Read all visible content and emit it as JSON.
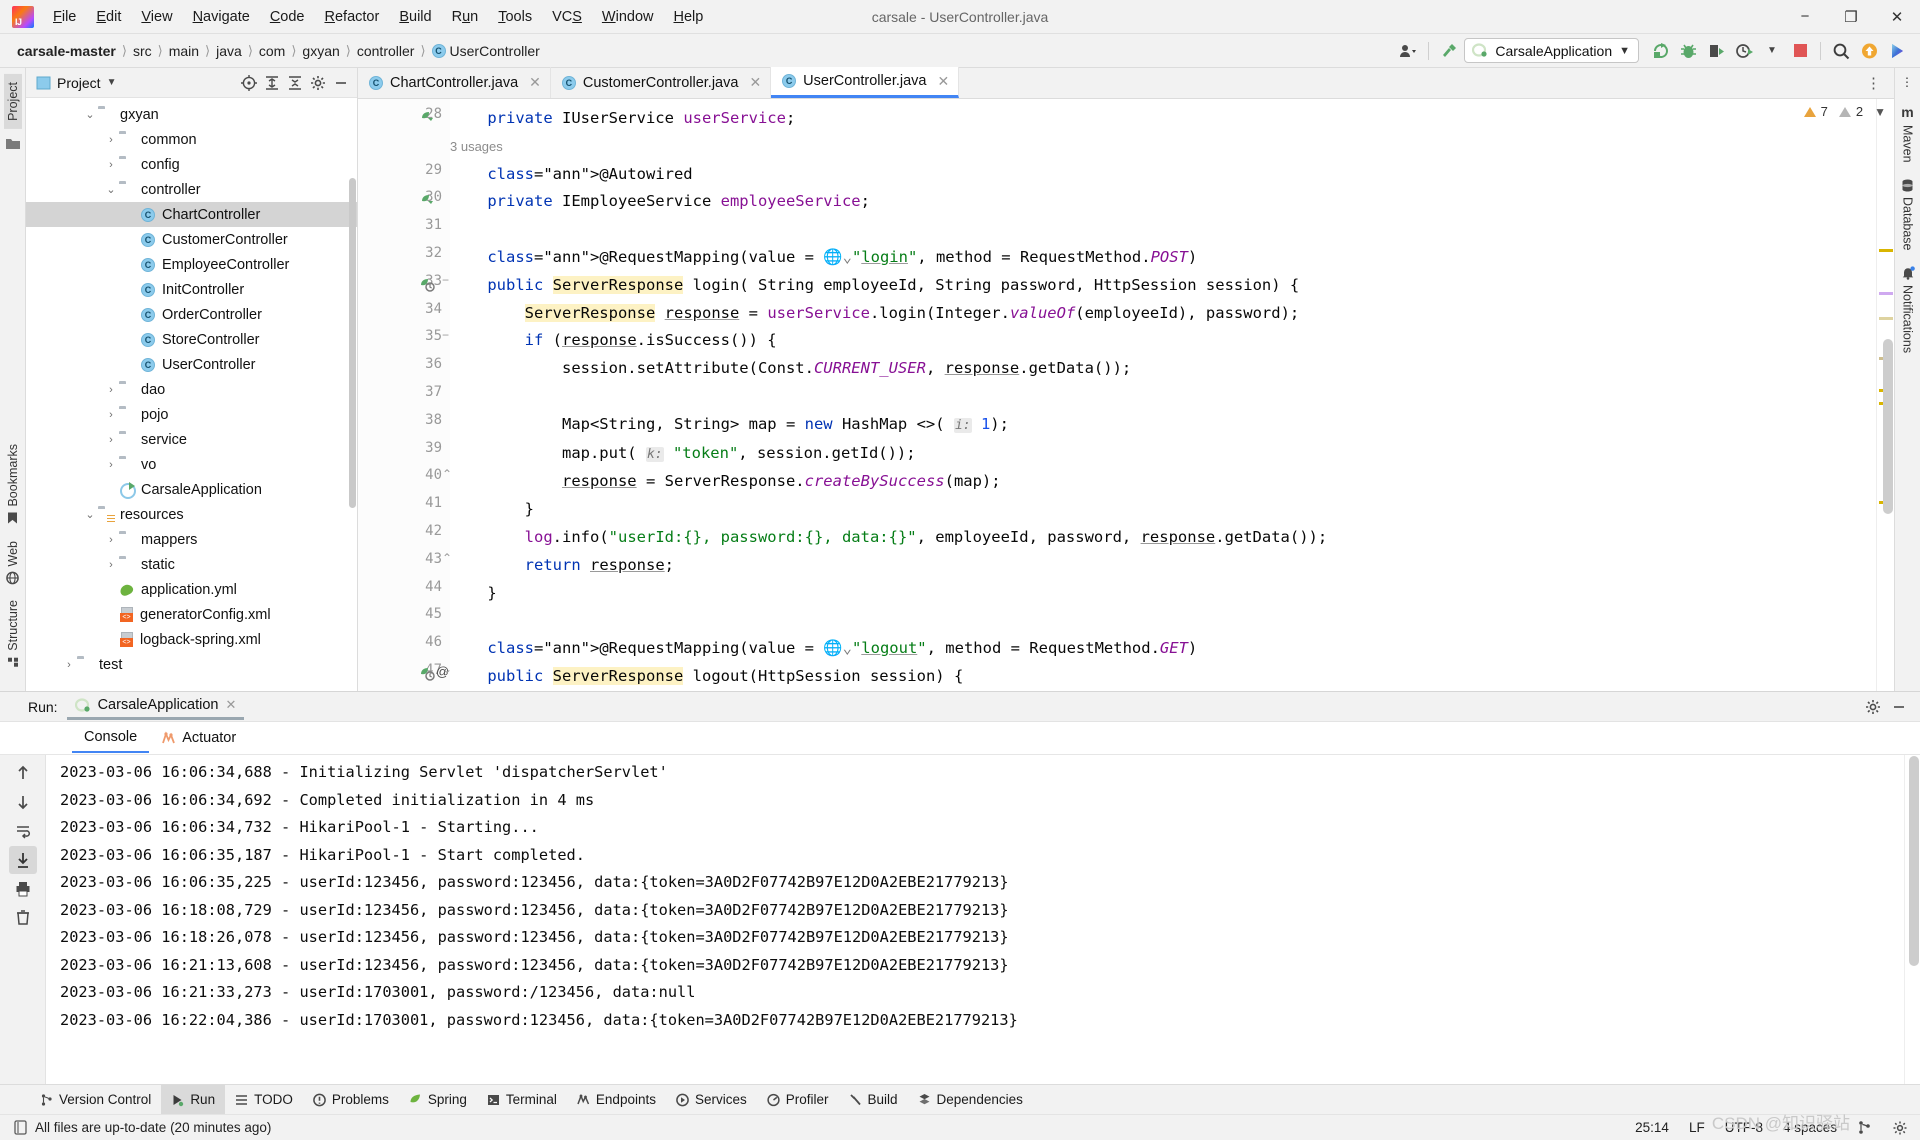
{
  "window": {
    "title": "carsale - UserController.java",
    "menu": [
      "File",
      "Edit",
      "View",
      "Navigate",
      "Code",
      "Refactor",
      "Build",
      "Run",
      "Tools",
      "VCS",
      "Window",
      "Help"
    ],
    "minimize": "−",
    "maximize": "❐",
    "close": "✕"
  },
  "navbar": {
    "breadcrumbs": [
      "carsale-master",
      "src",
      "main",
      "java",
      "com",
      "gxyan",
      "controller",
      "UserController"
    ],
    "separator": "〉",
    "run_config": "CarsaleApplication",
    "dropdown_caret": "▾"
  },
  "project_panel": {
    "title": "Project",
    "caret": "▾",
    "tree": [
      {
        "label": "gxyan",
        "indent": 2,
        "arrow": "open",
        "icon": "folder",
        "selected": false
      },
      {
        "label": "common",
        "indent": 3,
        "arrow": "closed",
        "icon": "folder",
        "selected": false
      },
      {
        "label": "config",
        "indent": 3,
        "arrow": "closed",
        "icon": "folder",
        "selected": false
      },
      {
        "label": "controller",
        "indent": 3,
        "arrow": "open",
        "icon": "folder",
        "selected": false
      },
      {
        "label": "ChartController",
        "indent": 4,
        "arrow": "none",
        "icon": "class",
        "selected": true
      },
      {
        "label": "CustomerController",
        "indent": 4,
        "arrow": "none",
        "icon": "class",
        "selected": false
      },
      {
        "label": "EmployeeController",
        "indent": 4,
        "arrow": "none",
        "icon": "class",
        "selected": false
      },
      {
        "label": "InitController",
        "indent": 4,
        "arrow": "none",
        "icon": "class",
        "selected": false
      },
      {
        "label": "OrderController",
        "indent": 4,
        "arrow": "none",
        "icon": "class",
        "selected": false
      },
      {
        "label": "StoreController",
        "indent": 4,
        "arrow": "none",
        "icon": "class",
        "selected": false
      },
      {
        "label": "UserController",
        "indent": 4,
        "arrow": "none",
        "icon": "class",
        "selected": false
      },
      {
        "label": "dao",
        "indent": 3,
        "arrow": "closed",
        "icon": "folder",
        "selected": false
      },
      {
        "label": "pojo",
        "indent": 3,
        "arrow": "closed",
        "icon": "folder",
        "selected": false
      },
      {
        "label": "service",
        "indent": 3,
        "arrow": "closed",
        "icon": "folder",
        "selected": false
      },
      {
        "label": "vo",
        "indent": 3,
        "arrow": "closed",
        "icon": "folder",
        "selected": false
      },
      {
        "label": "CarsaleApplication",
        "indent": 3,
        "arrow": "none",
        "icon": "spring-class",
        "selected": false
      },
      {
        "label": "resources",
        "indent": 2,
        "arrow": "open",
        "icon": "resources",
        "selected": false
      },
      {
        "label": "mappers",
        "indent": 3,
        "arrow": "closed",
        "icon": "folder-plain",
        "selected": false
      },
      {
        "label": "static",
        "indent": 3,
        "arrow": "closed",
        "icon": "folder-plain",
        "selected": false
      },
      {
        "label": "application.yml",
        "indent": 3,
        "arrow": "none",
        "icon": "yml",
        "selected": false
      },
      {
        "label": "generatorConfig.xml",
        "indent": 3,
        "arrow": "none",
        "icon": "xml",
        "selected": false
      },
      {
        "label": "logback-spring.xml",
        "indent": 3,
        "arrow": "none",
        "icon": "xml",
        "selected": false
      },
      {
        "label": "test",
        "indent": 1,
        "arrow": "closed",
        "icon": "folder-plain",
        "selected": false
      }
    ]
  },
  "editor": {
    "tabs": [
      {
        "label": "ChartController.java",
        "active": false
      },
      {
        "label": "CustomerController.java",
        "active": false
      },
      {
        "label": "UserController.java",
        "active": true
      }
    ],
    "close_glyph": "✕",
    "more_glyph": "⋮",
    "inspection": {
      "warnings": "7",
      "weak_warnings": "2",
      "warn_glyph": "⚠",
      "caret": "⌄"
    },
    "first_line_number": 28,
    "lines": [
      {
        "n": 28,
        "text": "    private IUserService userService;"
      },
      {
        "n": null,
        "text": "    3 usages"
      },
      {
        "n": 29,
        "text": "    @Autowired"
      },
      {
        "n": 30,
        "text": "    private IEmployeeService employeeService;"
      },
      {
        "n": 31,
        "text": ""
      },
      {
        "n": 32,
        "text": "    @RequestMapping(value = \"login\", method = RequestMethod.POST)"
      },
      {
        "n": 33,
        "text": "    public ServerResponse login( String employeeId, String password, HttpSession session) {"
      },
      {
        "n": 34,
        "text": "        ServerResponse response = userService.login(Integer.valueOf(employeeId), password);"
      },
      {
        "n": 35,
        "text": "        if (response.isSuccess()) {"
      },
      {
        "n": 36,
        "text": "            session.setAttribute(Const.CURRENT_USER, response.getData());"
      },
      {
        "n": 37,
        "text": ""
      },
      {
        "n": 38,
        "text": "            Map<String, String> map = new HashMap <>( i: 1);"
      },
      {
        "n": 39,
        "text": "            map.put( k: \"token\", session.getId());"
      },
      {
        "n": 40,
        "text": "            response = ServerResponse.createBySuccess(map);"
      },
      {
        "n": 41,
        "text": "        }"
      },
      {
        "n": 42,
        "text": "        log.info(\"userId:{}, password:{}, data:{}\", employeeId, password, response.getData());"
      },
      {
        "n": 43,
        "text": "        return response;"
      },
      {
        "n": 44,
        "text": "    }"
      },
      {
        "n": 45,
        "text": ""
      },
      {
        "n": 46,
        "text": "    @RequestMapping(value = \"logout\", method = RequestMethod.GET)"
      },
      {
        "n": 47,
        "text": "    public ServerResponse logout(HttpSession session) {"
      }
    ]
  },
  "run_panel": {
    "label": "Run:",
    "tab": "CarsaleApplication",
    "close_glyph": "✕",
    "subtabs": [
      {
        "label": "Console",
        "active": true
      },
      {
        "label": "Actuator",
        "active": false
      }
    ],
    "console_lines": [
      "2023-03-06 16:06:34,688 - Initializing Servlet 'dispatcherServlet'",
      "2023-03-06 16:06:34,692 - Completed initialization in 4 ms",
      "2023-03-06 16:06:34,732 - HikariPool-1 - Starting...",
      "2023-03-06 16:06:35,187 - HikariPool-1 - Start completed.",
      "2023-03-06 16:06:35,225 - userId:123456, password:123456, data:{token=3A0D2F07742B97E12D0A2EBE21779213}",
      "2023-03-06 16:18:08,729 - userId:123456, password:123456, data:{token=3A0D2F07742B97E12D0A2EBE21779213}",
      "2023-03-06 16:18:26,078 - userId:123456, password:123456, data:{token=3A0D2F07742B97E12D0A2EBE21779213}",
      "2023-03-06 16:21:13,608 - userId:123456, password:123456, data:{token=3A0D2F07742B97E12D0A2EBE21779213}",
      "2023-03-06 16:21:33,273 - userId:1703001, password:/123456, data:null",
      "2023-03-06 16:22:04,386 - userId:1703001, password:123456, data:{token=3A0D2F07742B97E12D0A2EBE21779213}"
    ]
  },
  "left_strip": {
    "top": [
      "Project"
    ],
    "bottom": [
      "Bookmarks",
      "Web",
      "Structure"
    ]
  },
  "right_strip": {
    "items": [
      "Maven",
      "Database",
      "Notifications"
    ]
  },
  "tool_window_bar": [
    {
      "label": "Version Control",
      "active": false
    },
    {
      "label": "Run",
      "active": true
    },
    {
      "label": "TODO",
      "active": false
    },
    {
      "label": "Problems",
      "active": false
    },
    {
      "label": "Spring",
      "active": false
    },
    {
      "label": "Terminal",
      "active": false
    },
    {
      "label": "Endpoints",
      "active": false
    },
    {
      "label": "Services",
      "active": false
    },
    {
      "label": "Profiler",
      "active": false
    },
    {
      "label": "Build",
      "active": false
    },
    {
      "label": "Dependencies",
      "active": false
    }
  ],
  "status_bar": {
    "message": "All files are up-to-date (20 minutes ago)",
    "caret_position": "25:14",
    "line_separator": "LF",
    "encoding": "UTF-8",
    "indent": "4 spaces"
  },
  "watermark": "CSDN @知识驿站",
  "colors": {
    "accent_blue": "#4285f4",
    "keyword": "#0033b3",
    "string": "#067d17",
    "annotation": "#9e880d",
    "field": "#871094",
    "static": "#871094",
    "warn": "#e8a33d",
    "stop_red": "#e05555",
    "spring_green": "#59a869"
  }
}
